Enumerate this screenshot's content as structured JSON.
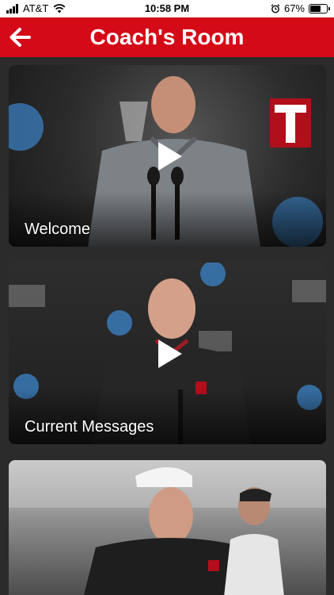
{
  "status_bar": {
    "carrier": "AT&T",
    "time": "10:58 PM",
    "battery": "67%",
    "battery_level": 0.67
  },
  "header": {
    "title": "Coach's Room",
    "back_icon": "arrow-left-icon",
    "color": "#d40a16"
  },
  "videos": [
    {
      "title": "Welcome"
    },
    {
      "title": "Current Messages"
    },
    {
      "title": ""
    }
  ]
}
